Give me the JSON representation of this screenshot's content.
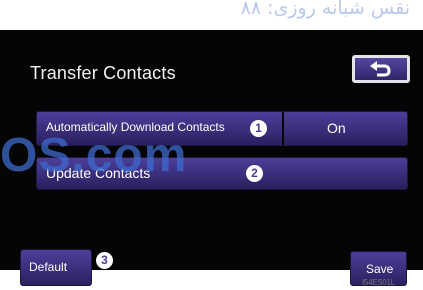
{
  "watermark_top": "نقس شبانه روزی: ۸۸",
  "title": "Transfer Contacts",
  "back_icon": "return-arrow-icon",
  "rows": [
    {
      "label": "Automatically Download Contacts",
      "value": "On",
      "marker": "1"
    },
    {
      "label": "Update Contacts",
      "marker": "2"
    }
  ],
  "watermark_mid": "OS.com",
  "default_button": {
    "label": "Default",
    "marker": "3"
  },
  "save_button": {
    "label": "Save"
  },
  "figure_code": "I54ES01L",
  "colors": {
    "panel_background": "#050505",
    "button_top": "#4c3f9a",
    "button_bottom": "#28205f",
    "marker_background": "#ffffff",
    "watermark": "#3d6acd"
  }
}
